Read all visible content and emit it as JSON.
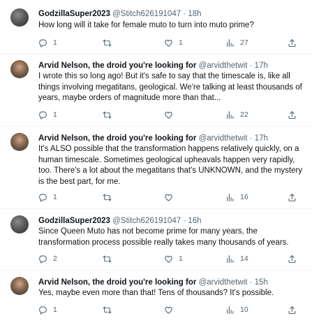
{
  "tweets": [
    {
      "name": "GodzillaSuper2023",
      "handle": "@Stitch626191047",
      "dot": "·",
      "time": "18h",
      "text": "How long will it take for female muto to turn into muto prime?",
      "replies": "1",
      "retweets": "",
      "likes": "1",
      "views": "27"
    },
    {
      "name": "Arvid Nelson, the droid you're looking for",
      "handle": "@arvidthetwit",
      "dot": "·",
      "time": "17h",
      "text": "I wrote this so long ago! But it's safe to say that the timescale is, like all things involving megatitans, geological. We're talking at least thousands of years, maybe orders of magnitude more than that...",
      "replies": "1",
      "retweets": "",
      "likes": "",
      "views": "22"
    },
    {
      "name": "Arvid Nelson, the droid you're looking for",
      "handle": "@arvidthetwit",
      "dot": "·",
      "time": "17h",
      "text": "It's ALSO possible that the transformation happens relatively quickly, on a human timescale. Sometimes geological upheavals happen very rapidly, too. There's a lot about the megatitans that's UNKNOWN, and the mystery is the best part, for me.",
      "replies": "1",
      "retweets": "",
      "likes": "",
      "views": "16"
    },
    {
      "name": "GodzillaSuper2023",
      "handle": "@Stitch626191047",
      "dot": "·",
      "time": "16h",
      "text": "Since Queen Muto has not become prime for many years, the transformation process possible really takes many thousands of years.",
      "replies": "2",
      "retweets": "",
      "likes": "1",
      "views": "14"
    },
    {
      "name": "Arvid Nelson, the droid you're looking for",
      "handle": "@arvidthetwit",
      "dot": "·",
      "time": "15h",
      "text": "Yes, maybe even more than that! Tens of thousands? It's possible.",
      "replies": "1",
      "retweets": "",
      "likes": "",
      "views": "10"
    }
  ],
  "icons": {
    "reply": "reply-icon",
    "retweet": "retweet-icon",
    "like": "heart-icon",
    "views": "views-chart-icon",
    "share": "share-icon"
  },
  "colors": {
    "text": "#0f1419",
    "secondary": "#536471",
    "divider": "#eff3f4"
  }
}
